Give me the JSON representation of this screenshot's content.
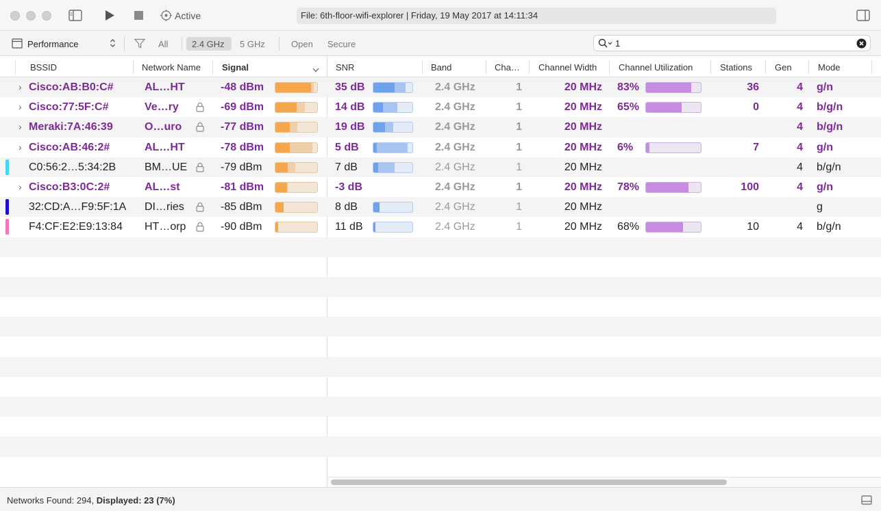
{
  "titlebar": {
    "status_label": "Active",
    "file_label": "File: 6th-floor-wifi-explorer | Friday, 19 May 2017 at 14:11:34"
  },
  "toolbar": {
    "view_select": "Performance",
    "filter_all": "All",
    "band_24": "2.4 GHz",
    "band_5": "5 GHz",
    "open_label": "Open",
    "secure_label": "Secure",
    "search_value": "1",
    "selected_band": "2.4 GHz"
  },
  "columns": {
    "bssid": "BSSID",
    "name": "Network Name",
    "signal": "Signal",
    "snr": "SNR",
    "band": "Band",
    "channel": "Cha…",
    "width": "Channel Width",
    "util": "Channel Utilization",
    "stations": "Stations",
    "gen": "Gen",
    "mode": "Mode"
  },
  "colors": {
    "accent_purple": "#7d2a98",
    "signal_fill": "#f6a64c",
    "snr_fill": "#6fa2ec",
    "util_fill": "#c98ce3"
  },
  "rows": [
    {
      "bssid": "Cisco:AB:B0:C#",
      "name": "AL…HT",
      "locked": false,
      "signal": "-48 dBm",
      "signal_level": 0.85,
      "signal_peak": 0.92,
      "snr": "35 dB",
      "snr_level": 0.55,
      "snr_peak": 0.82,
      "band": "2.4 GHz",
      "channel": "1",
      "width": "20 MHz",
      "util": "83%",
      "util_level": 0.83,
      "stations": "36",
      "gen": "4",
      "mode": "g/n",
      "expandable": true,
      "bold": true,
      "purple": true,
      "marker": ""
    },
    {
      "bssid": "Cisco:77:5F:C#",
      "name": "Ve…ry",
      "locked": true,
      "signal": "-69 dBm",
      "signal_level": 0.5,
      "signal_peak": 0.7,
      "snr": "14 dB",
      "snr_level": 0.25,
      "snr_peak": 0.62,
      "band": "2.4 GHz",
      "channel": "1",
      "width": "20 MHz",
      "util": "65%",
      "util_level": 0.65,
      "stations": "0",
      "gen": "4",
      "mode": "b/g/n",
      "expandable": true,
      "bold": true,
      "purple": true,
      "marker": ""
    },
    {
      "bssid": "Meraki:7A:46:39",
      "name": "O…uro",
      "locked": true,
      "signal": "-77 dBm",
      "signal_level": 0.35,
      "signal_peak": 0.52,
      "snr": "19 dB",
      "snr_level": 0.3,
      "snr_peak": 0.5,
      "band": "2.4 GHz",
      "channel": "1",
      "width": "20 MHz",
      "util": "",
      "util_level": null,
      "stations": "",
      "gen": "4",
      "mode": "b/g/n",
      "expandable": true,
      "bold": true,
      "purple": true,
      "marker": ""
    },
    {
      "bssid": "Cisco:AB:46:2#",
      "name": "AL…HT",
      "locked": false,
      "signal": "-78 dBm",
      "signal_level": 0.35,
      "signal_peak": 0.88,
      "snr": "5 dB",
      "snr_level": 0.08,
      "snr_peak": 0.88,
      "band": "2.4 GHz",
      "channel": "1",
      "width": "20 MHz",
      "util": "6%",
      "util_level": 0.06,
      "stations": "7",
      "gen": "4",
      "mode": "g/n",
      "expandable": true,
      "bold": true,
      "purple": true,
      "marker": ""
    },
    {
      "bssid": "C0:56:2…5:34:2B",
      "name": "BM…UE",
      "locked": true,
      "signal": "-79 dBm",
      "signal_level": 0.3,
      "signal_peak": 0.48,
      "snr": "7 dB",
      "snr_level": 0.12,
      "snr_peak": 0.55,
      "band": "2.4 GHz",
      "channel": "1",
      "width": "20 MHz",
      "util": "",
      "util_level": null,
      "stations": "",
      "gen": "4",
      "mode": "b/g/n",
      "expandable": false,
      "bold": false,
      "purple": false,
      "marker": "#46d6ee"
    },
    {
      "bssid": "Cisco:B3:0C:2#",
      "name": "AL…st",
      "locked": false,
      "signal": "-81 dBm",
      "signal_level": 0.28,
      "signal_peak": 0.3,
      "snr": "-3 dB",
      "snr_level": null,
      "snr_peak": null,
      "band": "2.4 GHz",
      "channel": "1",
      "width": "20 MHz",
      "util": "78%",
      "util_level": 0.78,
      "stations": "100",
      "gen": "4",
      "mode": "g/n",
      "expandable": true,
      "bold": true,
      "purple": true,
      "marker": ""
    },
    {
      "bssid": "32:CD:A…F9:5F:1A",
      "name": "DI…ries",
      "locked": true,
      "signal": "-85 dBm",
      "signal_level": 0.2,
      "signal_peak": 0.2,
      "snr": "8 dB",
      "snr_level": 0.15,
      "snr_peak": 0.15,
      "band": "2.4 GHz",
      "channel": "1",
      "width": "20 MHz",
      "util": "",
      "util_level": null,
      "stations": "",
      "gen": "",
      "mode": "g",
      "expandable": false,
      "bold": false,
      "purple": false,
      "marker": "#1c10c8"
    },
    {
      "bssid": "F4:CF:E2:E9:13:84",
      "name": "HT…orp",
      "locked": true,
      "signal": "-90 dBm",
      "signal_level": 0.06,
      "signal_peak": 0.06,
      "snr": "11 dB",
      "snr_level": 0.05,
      "snr_peak": 0.05,
      "band": "2.4 GHz",
      "channel": "1",
      "width": "20 MHz",
      "util": "68%",
      "util_level": 0.68,
      "stations": "10",
      "gen": "4",
      "mode": "b/g/n",
      "expandable": false,
      "bold": false,
      "purple": false,
      "marker": "#f07ab8"
    }
  ],
  "status": {
    "found_label": "Networks Found: 294, ",
    "displayed_label": "Displayed: 23 (7%)"
  }
}
